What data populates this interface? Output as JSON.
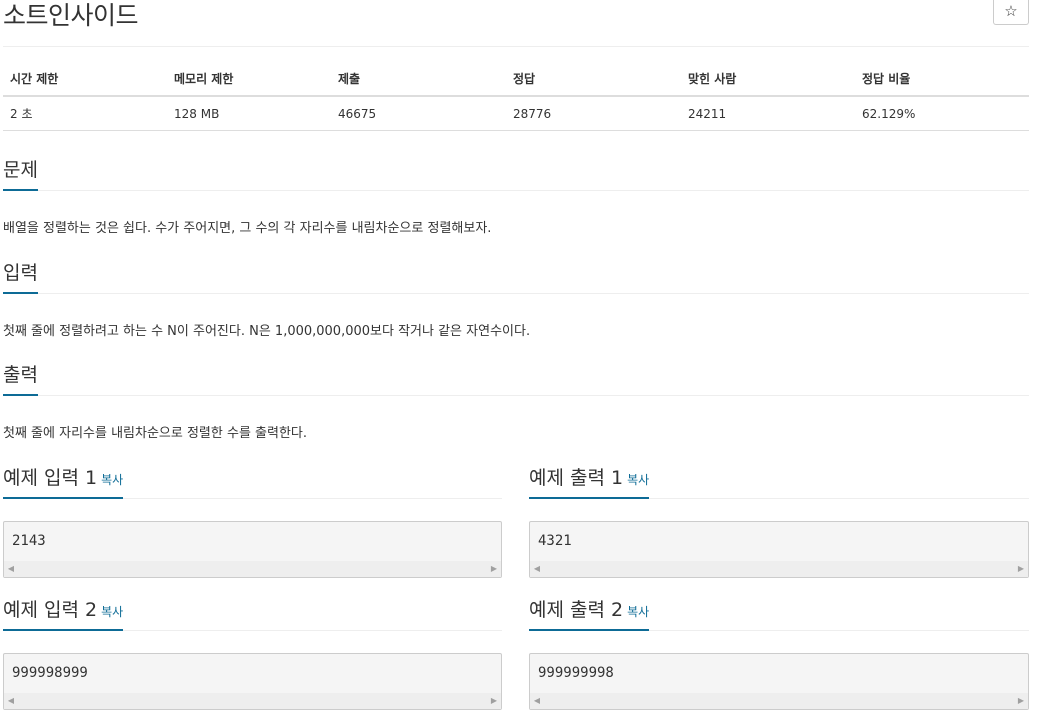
{
  "problem": {
    "title": "소트인사이드",
    "star_icon": "☆"
  },
  "info_table": {
    "headers": [
      "시간 제한",
      "메모리 제한",
      "제출",
      "정답",
      "맞힌 사람",
      "정답 비율"
    ],
    "values": [
      "2 초",
      "128 MB",
      "46675",
      "28776",
      "24211",
      "62.129%"
    ]
  },
  "sections": {
    "description": {
      "heading": "문제",
      "text": "배열을 정렬하는 것은 쉽다. 수가 주어지면, 그 수의 각 자리수를 내림차순으로 정렬해보자."
    },
    "input": {
      "heading": "입력",
      "text": "첫째 줄에 정렬하려고 하는 수 N이 주어진다. N은 1,000,000,000보다 작거나 같은 자연수이다."
    },
    "output": {
      "heading": "출력",
      "text": "첫째 줄에 자리수를 내림차순으로 정렬한 수를 출력한다."
    }
  },
  "samples": {
    "copy_label": "복사",
    "input1": {
      "heading": "예제 입력 1",
      "value": "2143"
    },
    "output1": {
      "heading": "예제 출력 1",
      "value": "4321"
    },
    "input2": {
      "heading": "예제 입력 2",
      "value": "999998999"
    },
    "output2": {
      "heading": "예제 출력 2",
      "value": "999999998"
    }
  },
  "scroll_icons": {
    "left": "◀",
    "right": "▶"
  }
}
